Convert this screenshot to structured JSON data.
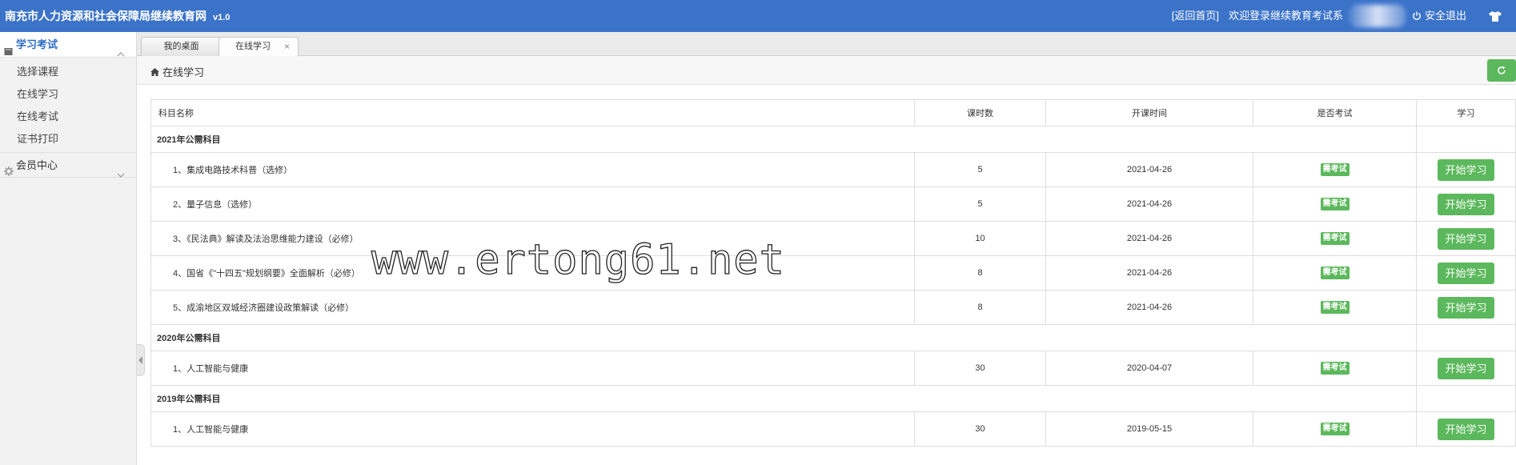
{
  "header": {
    "site_title": "南充市人力资源和社会保障局继续教育网",
    "version": "v1.0",
    "home_link": "[返回首页]",
    "welcome": "欢迎登录继续教育考试系",
    "logout": "安全退出",
    "bg_color": "#3b73c9"
  },
  "sidebar": {
    "groups": [
      {
        "label": "学习考试",
        "icon": "book-icon",
        "expanded": true,
        "items": [
          "选择课程",
          "在线学习",
          "在线考试",
          "证书打印"
        ]
      },
      {
        "label": "会员中心",
        "icon": "gear-icon",
        "expanded": false
      }
    ]
  },
  "tabs": [
    {
      "label": "我的桌面"
    },
    {
      "label": "在线学习",
      "active": true,
      "close": "×"
    }
  ],
  "breadcrumb": {
    "label": "在线学习",
    "icon": "home-icon"
  },
  "table": {
    "headers": [
      "科目名称",
      "课时数",
      "开课时间",
      "是否考试",
      "学习"
    ],
    "groups": [
      {
        "title": "2021年公需科目",
        "rows": [
          {
            "name": "1、集成电路技术科普（选修）",
            "hours": "5",
            "date": "2021-04-26",
            "exam": "需考试",
            "action": "开始学习"
          },
          {
            "name": "2、量子信息（选修）",
            "hours": "5",
            "date": "2021-04-26",
            "exam": "需考试",
            "action": "开始学习"
          },
          {
            "name": "3、《民法典》解读及法治思维能力建设（必修）",
            "hours": "10",
            "date": "2021-04-26",
            "exam": "需考试",
            "action": "开始学习"
          },
          {
            "name": "4、国省《\"十四五\"规划纲要》全面解析（必修）",
            "hours": "8",
            "date": "2021-04-26",
            "exam": "需考试",
            "action": "开始学习"
          },
          {
            "name": "5、成渝地区双城经济圈建设政策解读（必修）",
            "hours": "8",
            "date": "2021-04-26",
            "exam": "需考试",
            "action": "开始学习"
          }
        ]
      },
      {
        "title": "2020年公需科目",
        "rows": [
          {
            "name": "1、人工智能与健康",
            "hours": "30",
            "date": "2020-04-07",
            "exam": "需考试",
            "action": "开始学习"
          }
        ]
      },
      {
        "title": "2019年公需科目",
        "rows": [
          {
            "name": "1、人工智能与健康",
            "hours": "30",
            "date": "2019-05-15",
            "exam": "需考试",
            "action": "开始学习"
          }
        ]
      }
    ]
  },
  "watermark": "www.ertong61.net",
  "colors": {
    "primary": "#3b73c9",
    "success": "#5cb85c"
  }
}
